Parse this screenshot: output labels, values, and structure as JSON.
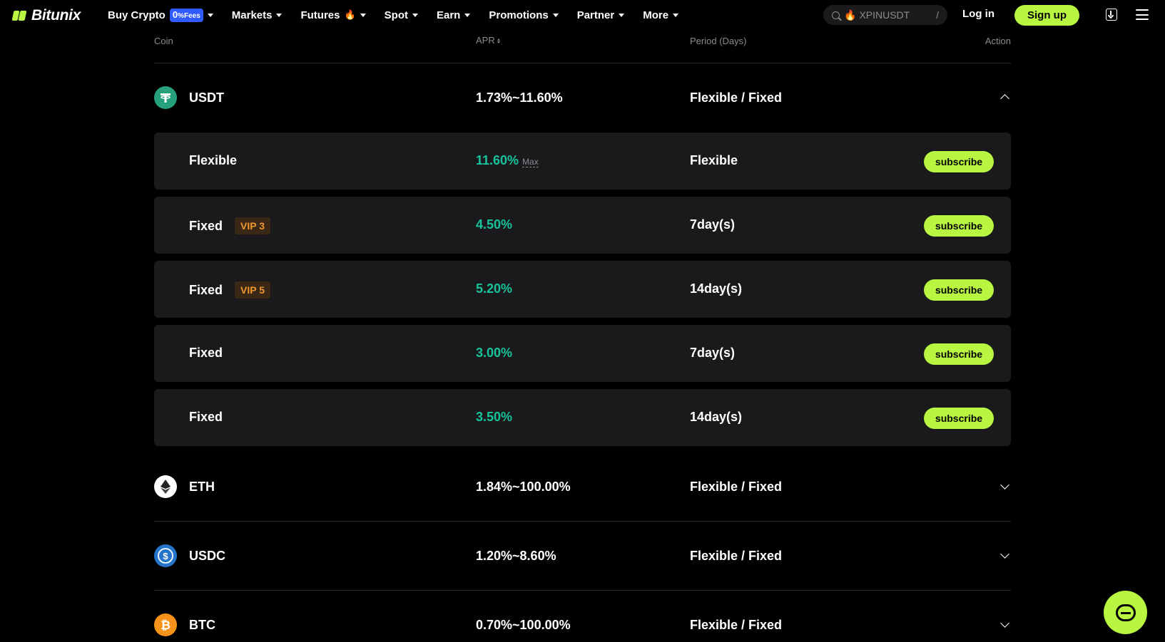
{
  "nav": {
    "brand": "Bitunix",
    "menu": [
      {
        "label": "Buy Crypto",
        "badge_num": "0",
        "badge_text": "%Fees"
      },
      {
        "label": "Markets"
      },
      {
        "label": "Futures"
      },
      {
        "label": "Spot"
      },
      {
        "label": "Earn"
      },
      {
        "label": "Promotions"
      },
      {
        "label": "Partner"
      },
      {
        "label": "More"
      }
    ],
    "search_placeholder": "XPINUSDT",
    "search_shortcut": "/",
    "login": "Log in",
    "signup": "Sign up"
  },
  "table": {
    "headers": {
      "coin": "Coin",
      "apr": "APR",
      "period": "Period (Days)",
      "action": "Action"
    },
    "coins": [
      {
        "name": "USDT",
        "apr": "1.73%~11.60%",
        "period": "Flexible / Fixed",
        "expanded": true,
        "icon": "tether-icon",
        "color": "#26a17b"
      },
      {
        "name": "ETH",
        "apr": "1.84%~100.00%",
        "period": "Flexible / Fixed",
        "expanded": false,
        "icon": "ethereum-icon",
        "color": "#ffffff"
      },
      {
        "name": "USDC",
        "apr": "1.20%~8.60%",
        "period": "Flexible / Fixed",
        "expanded": false,
        "icon": "usdc-icon",
        "color": "#2775ca"
      },
      {
        "name": "BTC",
        "apr": "0.70%~100.00%",
        "period": "Flexible / Fixed",
        "expanded": false,
        "icon": "bitcoin-icon",
        "color": "#f7931a"
      }
    ],
    "usdt_products": [
      {
        "type": "Flexible",
        "vip": "",
        "apr": "11.60%",
        "max": "Max",
        "period": "Flexible",
        "action": "subscribe"
      },
      {
        "type": "Fixed",
        "vip": "VIP 3",
        "apr": "4.50%",
        "max": "",
        "period": "7day(s)",
        "action": "subscribe"
      },
      {
        "type": "Fixed",
        "vip": "VIP 5",
        "apr": "5.20%",
        "max": "",
        "period": "14day(s)",
        "action": "subscribe"
      },
      {
        "type": "Fixed",
        "vip": "",
        "apr": "3.00%",
        "max": "",
        "period": "7day(s)",
        "action": "subscribe"
      },
      {
        "type": "Fixed",
        "vip": "",
        "apr": "3.50%",
        "max": "",
        "period": "14day(s)",
        "action": "subscribe"
      }
    ]
  },
  "colors": {
    "accent": "#b9f641",
    "apr_green": "#17c39a",
    "vip_orange": "#f0962a"
  }
}
